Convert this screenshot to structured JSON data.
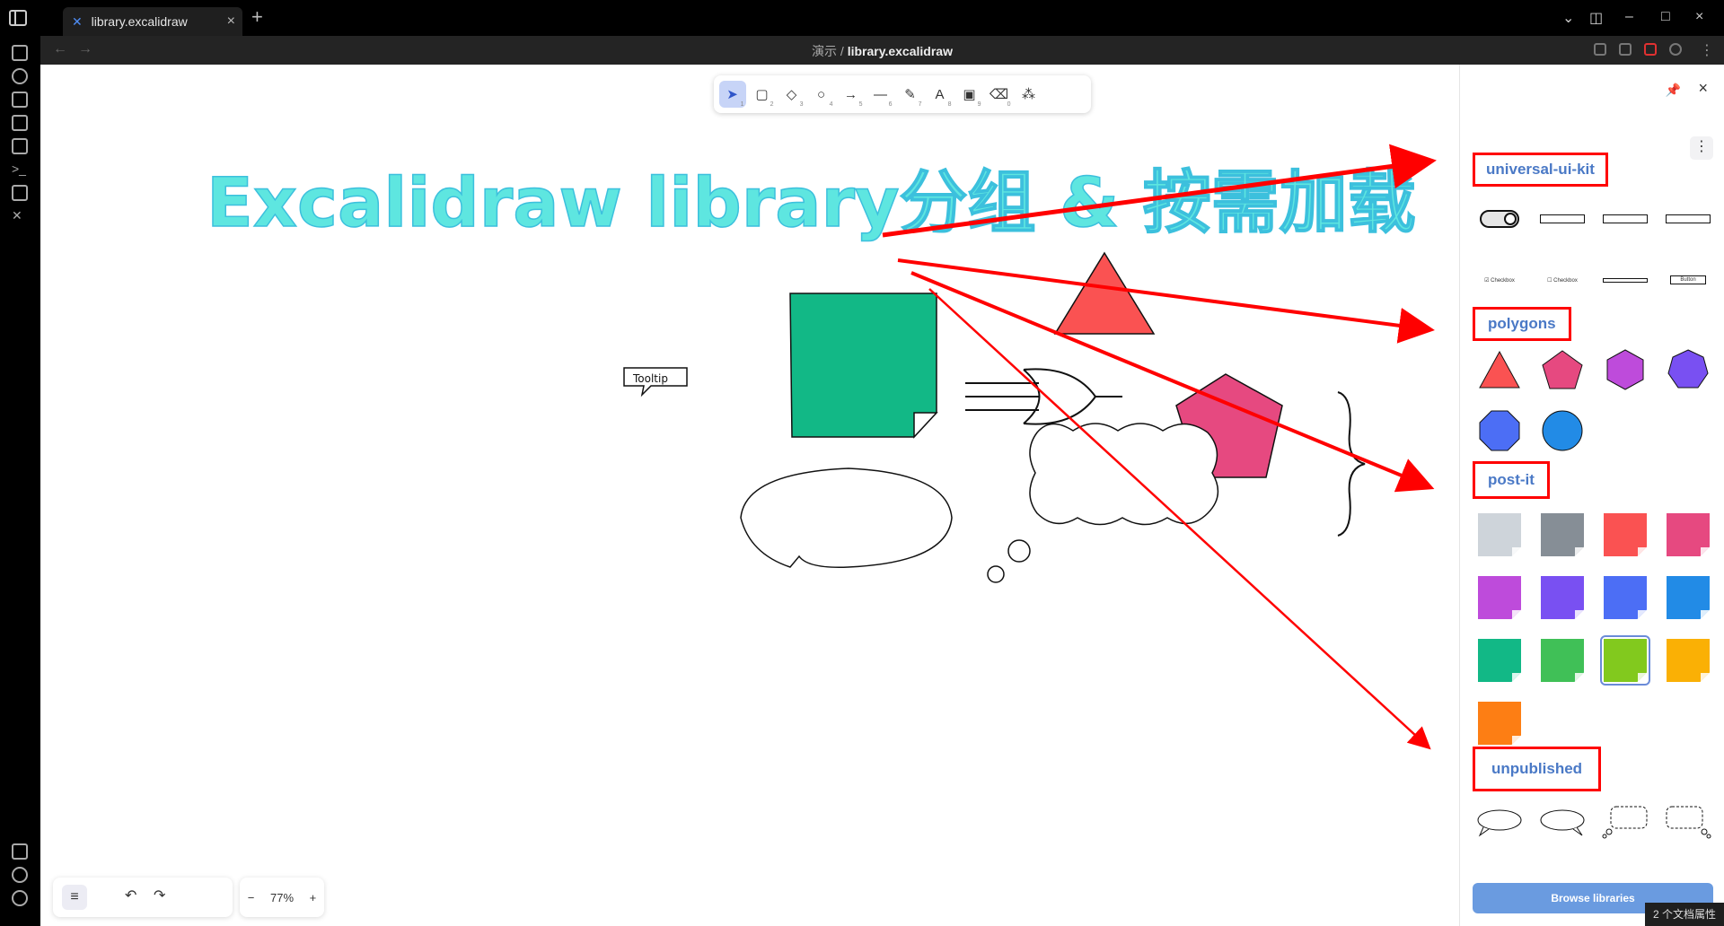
{
  "window": {
    "tab_title": "library.excalidraw",
    "tab_icon": "✕",
    "path_folder": "演示",
    "path_sep": "/",
    "path_file": "library.excalidraw"
  },
  "canvas": {
    "headline": "Excalidraw library分组 & 按需加载",
    "tooltip_label": "Tooltip",
    "zoom": "77%",
    "headline_color": "#5ee6e0",
    "arrow_color": "#ff0000"
  },
  "toolbar": {
    "tools": [
      {
        "name": "selection-tool",
        "icon": "➤",
        "num": "1"
      },
      {
        "name": "rectangle-tool",
        "icon": "▢",
        "num": "2"
      },
      {
        "name": "diamond-tool",
        "icon": "◇",
        "num": "3"
      },
      {
        "name": "ellipse-tool",
        "icon": "○",
        "num": "4"
      },
      {
        "name": "arrow-tool",
        "icon": "→",
        "num": "5"
      },
      {
        "name": "line-tool",
        "icon": "—",
        "num": "6"
      },
      {
        "name": "pencil-tool",
        "icon": "✎",
        "num": "7"
      },
      {
        "name": "text-tool",
        "icon": "A",
        "num": "8"
      },
      {
        "name": "image-tool",
        "icon": "▣",
        "num": "9"
      },
      {
        "name": "eraser-tool",
        "icon": "⌫",
        "num": "0"
      },
      {
        "name": "extra-tools",
        "icon": "⁂",
        "num": ""
      }
    ]
  },
  "library": {
    "sections": {
      "universal_ui_kit": "universal-ui-kit",
      "polygons": "polygons",
      "post_it": "post-it",
      "unpublished": "unpublished"
    },
    "ui_kit_labels": [
      "Checkbox",
      "Checkbox",
      "Button"
    ],
    "polygon_colors": [
      "#fa5252",
      "#e64980",
      "#be4bdb",
      "#7950f2",
      "#4c6ef5",
      "#228be6"
    ],
    "postit_colors": [
      "#ced4da",
      "#868e96",
      "#fa5252",
      "#e64980",
      "#be4bdb",
      "#7950f2",
      "#4c6ef5",
      "#228be6",
      "#12b886",
      "#40c057",
      "#82c91e",
      "#fab005",
      "#fd7e14"
    ],
    "browse_label": "Browse libraries"
  },
  "status": {
    "doc_props": "2 个文档属性"
  }
}
